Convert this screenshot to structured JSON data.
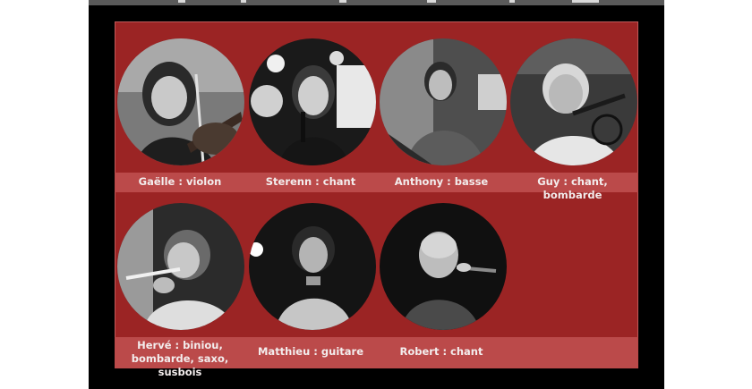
{
  "musicians": [
    {
      "id": "gaelle",
      "caption": "Gaëlle : violon"
    },
    {
      "id": "sterenn",
      "caption": "Sterenn : chant"
    },
    {
      "id": "anthony",
      "caption": "Anthony : basse"
    },
    {
      "id": "guy",
      "caption": "Guy : chant, bombarde"
    },
    {
      "id": "herve",
      "caption": "Hervé : biniou, bombarde, saxo, susbois"
    },
    {
      "id": "matthieu",
      "caption": "Matthieu : guitare"
    },
    {
      "id": "robert",
      "caption": "Robert : chant"
    }
  ],
  "colors": {
    "panel": "#9b2424",
    "caption_band": "#bb4a4a",
    "caption_text": "#f3eded",
    "background": "#000000"
  }
}
